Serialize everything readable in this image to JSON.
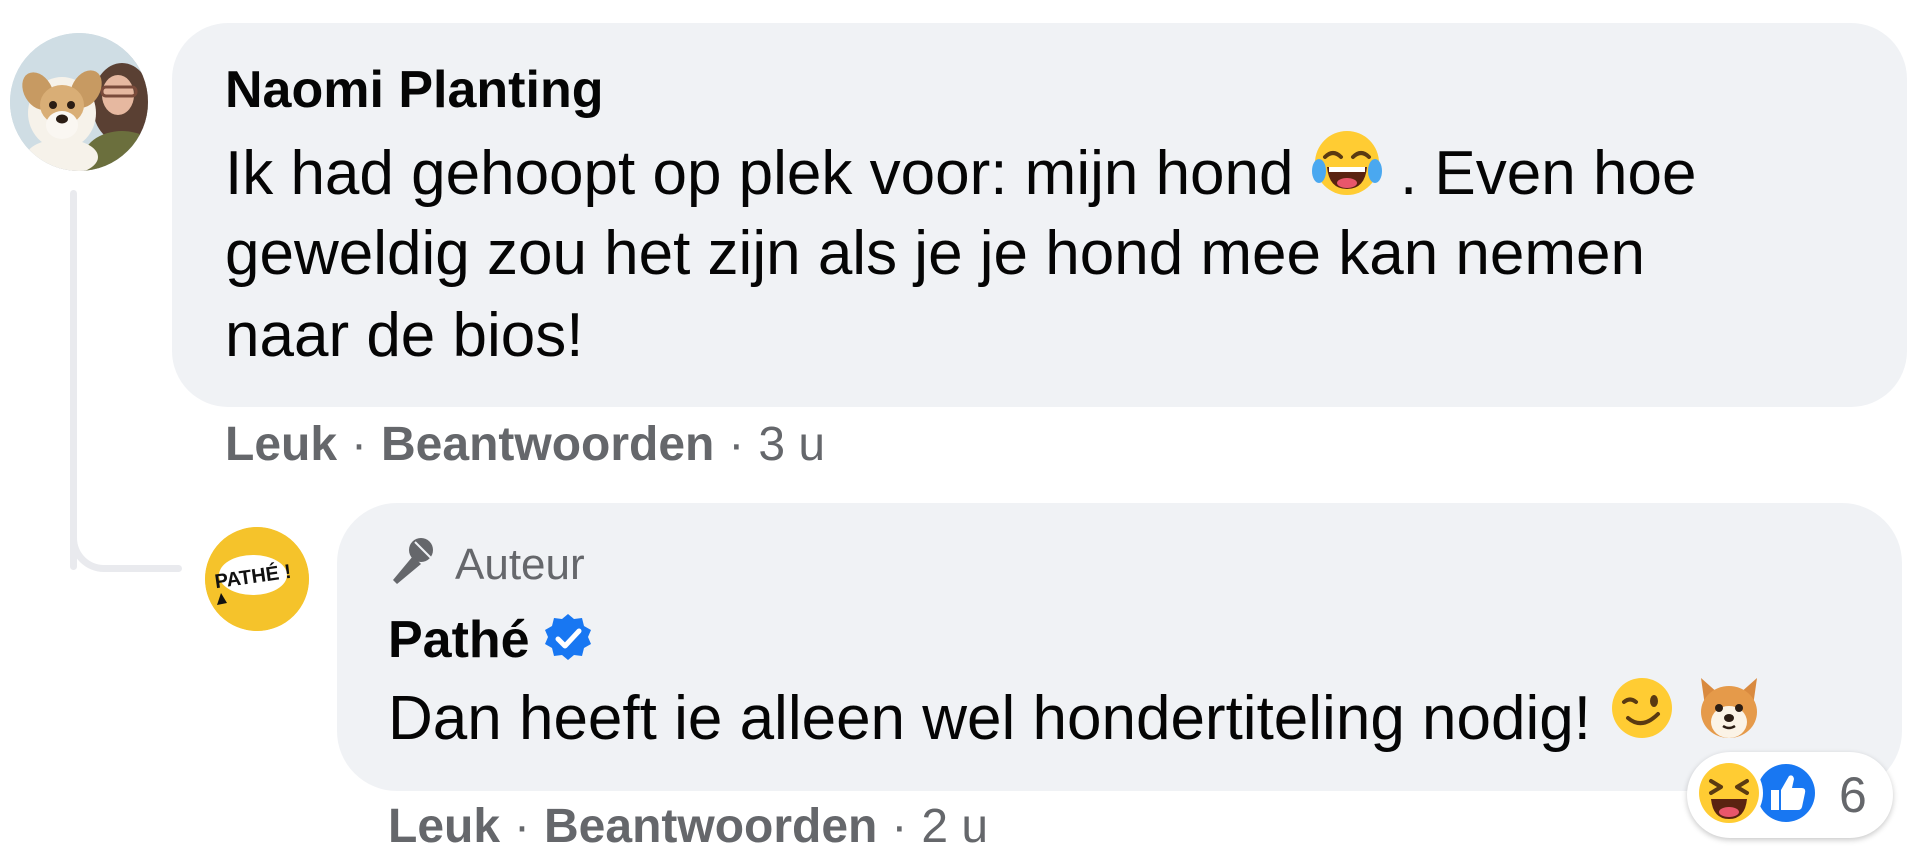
{
  "comment": {
    "author": "Naomi Planting",
    "text_line1_before_emoji": "Ik had gehoopt op plek voor: mijn hond",
    "text_line1_after_emoji": ". Even hoe",
    "text_line2": "geweldig zou het zijn als je je hond mee kan nemen",
    "text_line3": "naar de bios!",
    "emoji": "laughing-tears-emoji",
    "actions": {
      "like_label": "Leuk",
      "separator": "·",
      "reply_label": "Beantwoorden",
      "time": "3 u"
    }
  },
  "reply": {
    "badge_label": "Auteur",
    "author": "Pathé",
    "verified": true,
    "text": "Dan heeft ie alleen wel hondertiteling nodig!",
    "emojis": [
      "wink-emoji",
      "dog-face-emoji"
    ],
    "avatar_text": "PATHÉ !",
    "actions": {
      "like_label": "Leuk",
      "separator": "·",
      "reply_label": "Beantwoorden",
      "time": "2 u"
    },
    "reactions": {
      "icons": [
        "haha-reaction-icon",
        "like-reaction-icon"
      ],
      "count": "6"
    }
  },
  "colors": {
    "bubble": "#f0f2f5",
    "secondary_text": "#65676b",
    "verified_blue": "#1877f2",
    "pathe_yellow": "#f5c32b"
  }
}
